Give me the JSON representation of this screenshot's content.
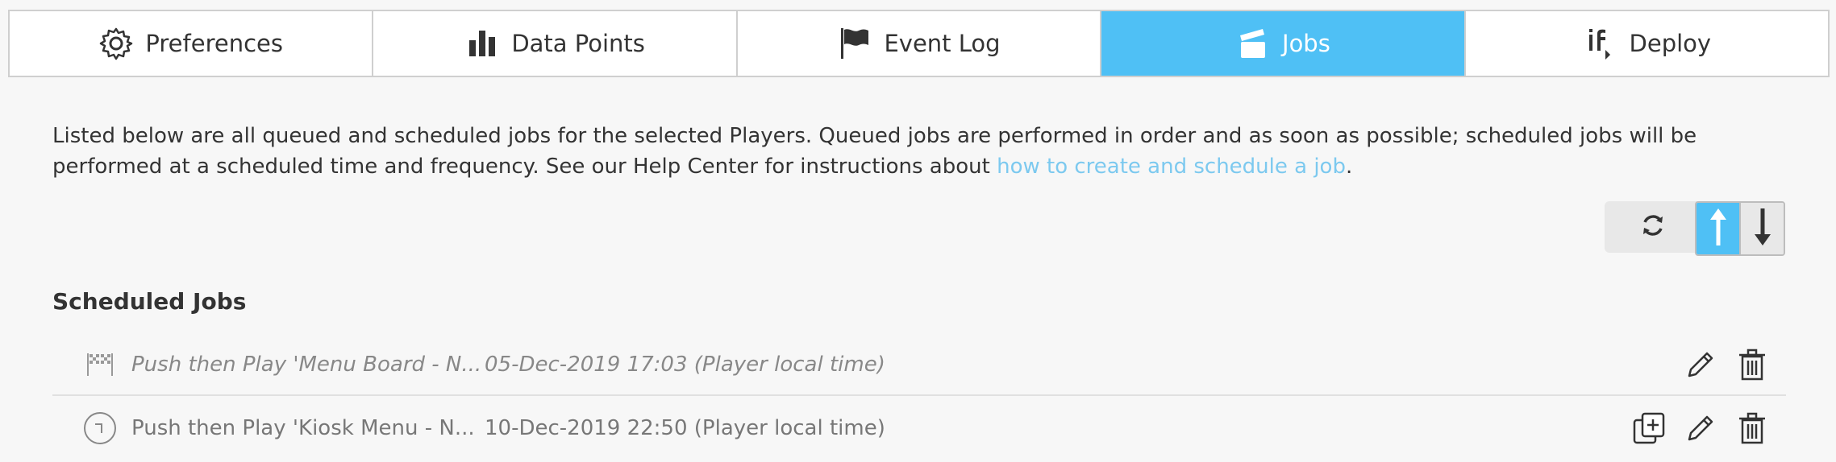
{
  "tabs": [
    {
      "label": "Preferences",
      "icon": "gear-icon",
      "active": false
    },
    {
      "label": "Data Points",
      "icon": "bar-chart-icon",
      "active": false
    },
    {
      "label": "Event Log",
      "icon": "flag-icon",
      "active": false
    },
    {
      "label": "Jobs",
      "icon": "clapperboard-icon",
      "active": true
    },
    {
      "label": "Deploy",
      "icon": "if-logic-icon",
      "active": false
    }
  ],
  "description": {
    "text": "Listed below are all queued and scheduled jobs for the selected Players. Queued jobs are performed in order and as soon as possible; scheduled jobs will be performed at a scheduled time and frequency. See our Help Center for instructions about ",
    "link": "how to create and schedule a job",
    "suffix": "."
  },
  "section_title": "Scheduled Jobs",
  "jobs": [
    {
      "name": "Push then Play 'Menu Board - N...",
      "time": "05-Dec-2019 17:03 (Player local time)",
      "icon": "checkered-flags-icon"
    },
    {
      "name": "Push then Play 'Kiosk Menu - N...",
      "time": "10-Dec-2019 22:50 (Player local time)",
      "icon": "clock-icon"
    }
  ],
  "colors": {
    "accent": "#4fc0f5",
    "link": "#7cc9ef",
    "border": "#cfcfcf",
    "text": "#333333"
  }
}
